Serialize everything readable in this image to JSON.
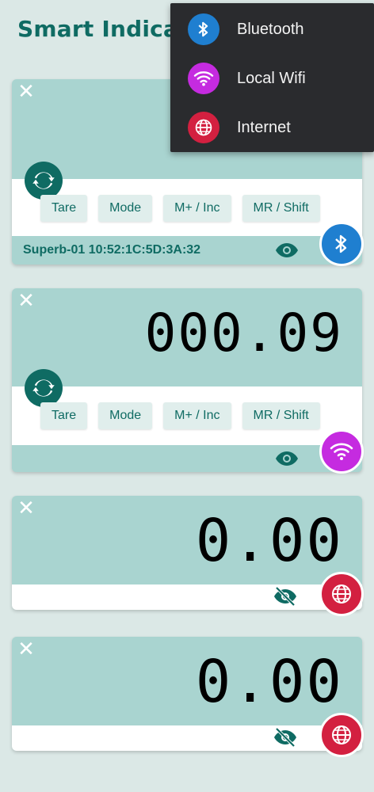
{
  "app": {
    "title": "Smart Indica"
  },
  "buttons": [
    "Tare",
    "Mode",
    "M+ / Inc",
    "MR / Shift"
  ],
  "cards": [
    {
      "device_label": "Superb-01 10:52:1C:5D:3A:32",
      "display": "",
      "connection": "bluetooth"
    },
    {
      "device_label": "",
      "display": "000.09",
      "connection": "wifi"
    },
    {
      "device_label": "",
      "display": "0.00",
      "connection": "internet"
    },
    {
      "device_label": "",
      "display": "0.00",
      "connection": "internet"
    }
  ],
  "menu": {
    "items": [
      {
        "label": "Bluetooth",
        "icon": "bluetooth-icon"
      },
      {
        "label": "Local Wifi",
        "icon": "wifi-icon"
      },
      {
        "label": "Internet",
        "icon": "globe-icon"
      }
    ]
  },
  "close_symbol": "✕",
  "colors": {
    "accent": "#0f6b63",
    "card": "#a9d4d0",
    "background": "#dbe8e6",
    "bluetooth": "#1f7fd0",
    "wifi": "#c52be0",
    "internet": "#d32040",
    "menu_bg": "#2a2b2e"
  }
}
